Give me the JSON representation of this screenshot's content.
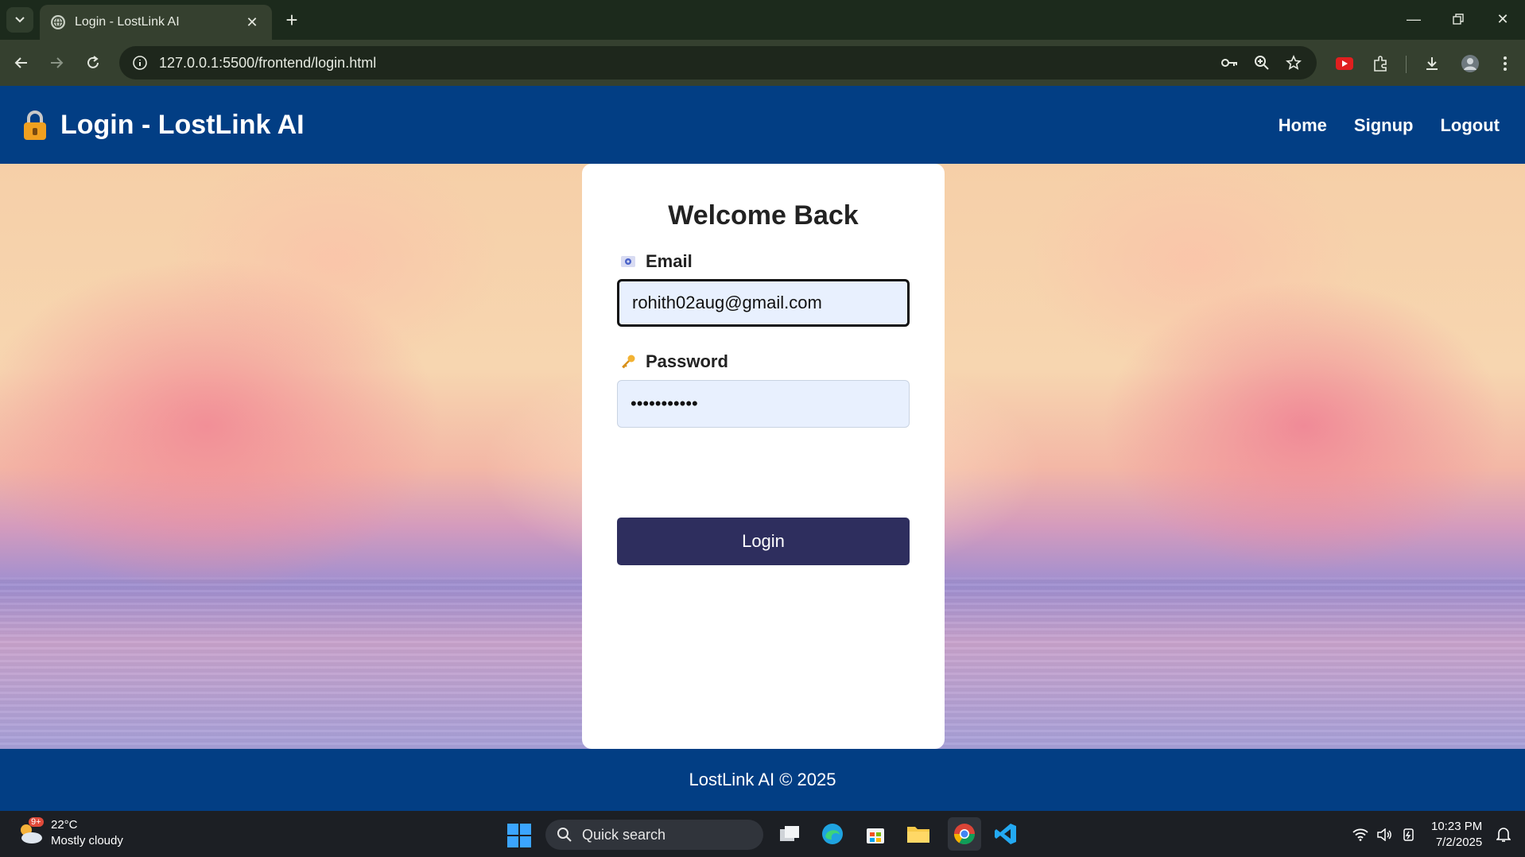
{
  "browser": {
    "tab_title": "Login - LostLink AI",
    "url": "127.0.0.1:5500/frontend/login.html"
  },
  "header": {
    "brand": "Login - LostLink AI",
    "nav": [
      "Home",
      "Signup",
      "Logout"
    ]
  },
  "form": {
    "heading": "Welcome Back",
    "email_label": "Email",
    "email_value": "rohith02aug@gmail.com",
    "password_label": "Password",
    "password_value": "•••••••••••",
    "submit_label": "Login"
  },
  "footer": {
    "text": "LostLink AI © 2025"
  },
  "taskbar": {
    "weather_badge": "9+",
    "temperature": "22°C",
    "condition": "Mostly cloudy",
    "search_label": "Quick search",
    "time": "10:23 PM",
    "date": "7/2/2025"
  },
  "colors": {
    "header_bg": "#023e84",
    "button_bg": "#2e2e5e",
    "input_bg": "#e8f0fe"
  }
}
